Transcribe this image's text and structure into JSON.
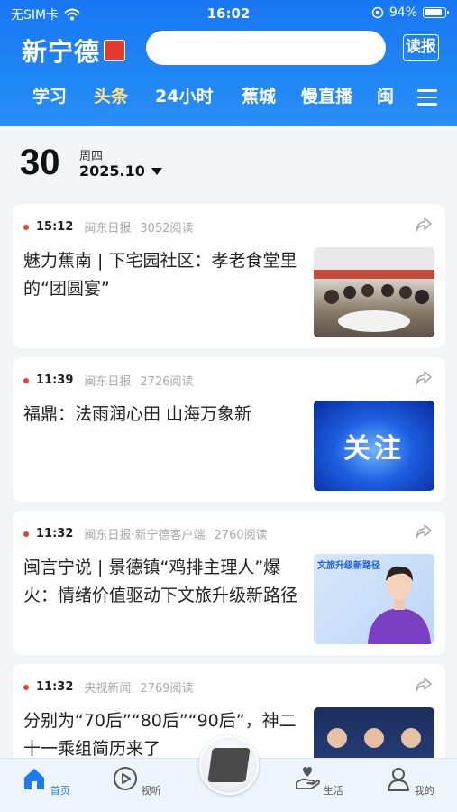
{
  "status_bar": {
    "carrier": "无SIM卡",
    "time": "16:02",
    "battery": "94%"
  },
  "header": {
    "logo_text": "新宁德",
    "read_button": "读报",
    "tabs": [
      {
        "label": "学习",
        "active": false
      },
      {
        "label": "头条",
        "active": true
      },
      {
        "label": "24小时",
        "active": false
      },
      {
        "label": "蕉城",
        "active": false
      },
      {
        "label": "慢直播",
        "active": false
      },
      {
        "label": "闽",
        "active": false
      }
    ]
  },
  "date": {
    "day": "30",
    "weekday": "周四",
    "year_month": "2025.10"
  },
  "articles": [
    {
      "time": "15:12",
      "source": "闽东日报",
      "reads": "3052阅读",
      "title": "魅力蕉南 | 下宅园社区：孝老食堂里的“团圆宴”"
    },
    {
      "time": "11:39",
      "source": "闽东日报",
      "reads": "2726阅读",
      "title": "福鼎：法雨润心田 山海万象新",
      "thumb_text": "关注"
    },
    {
      "time": "11:32",
      "source": "闽东日报·新宁德客户端",
      "reads": "2760阅读",
      "title": "闽言宁说 | 景德镇“鸡排主理人”爆火：情绪价值驱动下文旅升级新路径",
      "thumb_text": "文旅升级新路径"
    },
    {
      "time": "11:32",
      "source": "央视新闻",
      "reads": "2769阅读",
      "title": "分别为“70后”“80后”“90后”，神二十一乘组简历来了"
    }
  ],
  "bottom_nav": [
    {
      "label": "首页",
      "icon": "home-icon",
      "active": true
    },
    {
      "label": "视听",
      "icon": "play-icon",
      "active": false
    },
    {
      "label": "生活",
      "icon": "hand-heart-icon",
      "active": false
    },
    {
      "label": "我的",
      "icon": "user-icon",
      "active": false
    }
  ],
  "colors": {
    "header_blue": "#1877f2",
    "active_tab": "#ffe28a",
    "accent_red": "#e8432e",
    "nav_active": "#1d7cf2"
  }
}
